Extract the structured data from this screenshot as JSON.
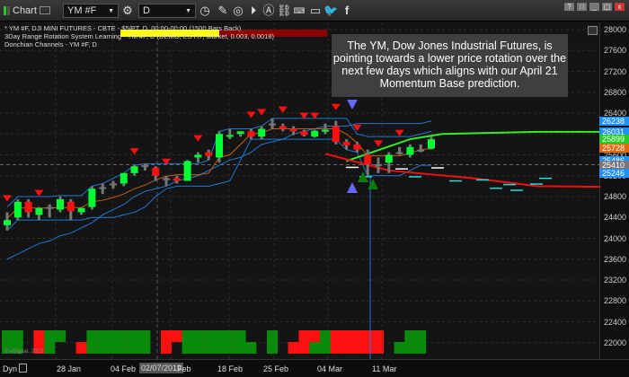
{
  "toolbar": {
    "app_label": "Chart",
    "symbol": "YM #F",
    "interval": "D",
    "icons": [
      "settings-icon",
      "clock-icon",
      "pencil-icon",
      "chart-link-icon",
      "play-icon",
      "alert-icon",
      "link-icon",
      "keyboard-icon",
      "chat-icon",
      "twitter-icon",
      "facebook-icon"
    ],
    "window_buttons": [
      "?",
      "□",
      "_",
      "▢",
      "x"
    ]
  },
  "legend": {
    "line1": "* YM #F, DJI MINI FUTURES - CBTE - $5/PT, D, 00:00-00:00 (1500 Bars Back)",
    "line2": "3Day Range Rotation System Learning - YM #F, D (DEMO, ES H7, Market, 0.003, 0.0018)",
    "line3": "Donchian Channels - YM #F, D"
  },
  "annotation": "The YM, Dow Jones Industrial Futures, is pointing towards a lower price rotation over the next few days which aligns with our April 21 Momentum Base prediction.",
  "copyright": "© eSignal, 2019",
  "time_axis": {
    "dyn": "Dyn",
    "labels": [
      "28 Jan",
      "04 Feb",
      "Feb",
      "18 Feb",
      "25 Feb",
      "04 Mar",
      "11 Mar"
    ],
    "cursor_date": "02/07/2019"
  },
  "price_badges": [
    {
      "value": "26238",
      "color": "#1e90ff"
    },
    {
      "value": "26031",
      "color": "#1e90ff"
    },
    {
      "value": "25899",
      "color": "#22cc22"
    },
    {
      "value": "25728",
      "color": "#e06a10"
    },
    {
      "value": "25486",
      "color": "#1e90ff"
    },
    {
      "value": "25410",
      "color": "#777777"
    },
    {
      "value": "25246",
      "color": "#1e90ff"
    }
  ],
  "chart_data": {
    "type": "candlestick",
    "ylim": [
      21600,
      28000
    ],
    "yticks": [
      28000,
      27600,
      27200,
      26800,
      26400,
      26000,
      25600,
      25200,
      24800,
      24400,
      24000,
      23600,
      23200,
      22800,
      22400,
      22000,
      21600
    ],
    "candles": [
      [
        24250,
        24500,
        24150,
        24350
      ],
      [
        24400,
        24750,
        24350,
        24700
      ],
      [
        24700,
        24750,
        24400,
        24500
      ],
      [
        24450,
        24600,
        24350,
        24580
      ],
      [
        24580,
        24650,
        24400,
        24600
      ],
      [
        24550,
        24800,
        24500,
        24750
      ],
      [
        24700,
        24750,
        24350,
        24520
      ],
      [
        24500,
        24600,
        24450,
        24580
      ],
      [
        24600,
        25000,
        24550,
        24950
      ],
      [
        24980,
        25050,
        24850,
        24980
      ],
      [
        25050,
        25100,
        24950,
        25050
      ],
      [
        25050,
        25250,
        25000,
        25250
      ],
      [
        25250,
        25400,
        25200,
        25380
      ],
      [
        25400,
        25430,
        25300,
        25400
      ],
      [
        25350,
        25380,
        25100,
        25200
      ],
      [
        25150,
        25200,
        25000,
        25150
      ],
      [
        25150,
        25200,
        25050,
        25100
      ],
      [
        25100,
        25500,
        25100,
        25480
      ],
      [
        25550,
        25650,
        25450,
        25600
      ],
      [
        25650,
        25700,
        25500,
        25580
      ],
      [
        25550,
        26050,
        25450,
        26000
      ],
      [
        25950,
        26100,
        25900,
        25980
      ],
      [
        26000,
        26050,
        25950,
        26050
      ],
      [
        26050,
        26100,
        25900,
        25950
      ],
      [
        25950,
        26150,
        25900,
        26100
      ],
      [
        26200,
        26300,
        26100,
        26200
      ],
      [
        26150,
        26200,
        26050,
        26100
      ],
      [
        26100,
        26150,
        25980,
        26050
      ],
      [
        26050,
        26080,
        25950,
        25980
      ],
      [
        25950,
        26080,
        25930,
        26060
      ],
      [
        26050,
        26200,
        26000,
        26080
      ],
      [
        26150,
        26250,
        25800,
        25850
      ],
      [
        25850,
        25900,
        25700,
        25780
      ],
      [
        25800,
        25850,
        25650,
        25700
      ],
      [
        25600,
        25700,
        25200,
        25420
      ],
      [
        25420,
        25550,
        25250,
        25400
      ],
      [
        25450,
        25650,
        25250,
        25600
      ],
      [
        25650,
        25750,
        25600,
        25630
      ],
      [
        25600,
        25800,
        25550,
        25750
      ],
      [
        25700,
        25800,
        25650,
        25700
      ],
      [
        25720,
        25950,
        25700,
        25900
      ]
    ],
    "donchian_upper": [
      24600,
      24800,
      24800,
      24800,
      24800,
      24820,
      24820,
      24820,
      25000,
      25050,
      25150,
      25250,
      25400,
      25430,
      25430,
      25430,
      25430,
      25430,
      25430,
      25500,
      26050,
      26100,
      26100,
      26100,
      26150,
      26300,
      26300,
      26300,
      26300,
      26300,
      26300,
      26300,
      26300,
      26000,
      25950,
      25950,
      25950,
      25950,
      25950,
      26000,
      26050
    ],
    "donchian_lower": [
      24150,
      24350,
      24350,
      24350,
      24350,
      24350,
      24350,
      24350,
      24400,
      24400,
      24400,
      24450,
      24500,
      24600,
      24800,
      24950,
      25000,
      25000,
      25000,
      25000,
      25050,
      25100,
      25500,
      25900,
      25900,
      25900,
      25900,
      25900,
      25900,
      25900,
      25900,
      25900,
      25700,
      25650,
      25200,
      25200,
      25200,
      25200,
      25300,
      25400,
      25400
    ],
    "donchian_mid": [
      24380,
      24580,
      24580,
      24580,
      24580,
      24590,
      24590,
      24590,
      24700,
      24730,
      24780,
      24850,
      24950,
      25020,
      25120,
      25190,
      25220,
      25220,
      25220,
      25250,
      25550,
      25600,
      25800,
      26000,
      26020,
      26100,
      26100,
      26100,
      26100,
      26100,
      26100,
      26100,
      26000,
      25830,
      25580,
      25580,
      25580,
      25580,
      25630,
      25700,
      25720
    ],
    "outer_band": [
      23600,
      23700,
      23800,
      23900,
      23950,
      24050,
      24100,
      24200,
      24300,
      24450,
      24550,
      24650,
      24800,
      24900,
      24950,
      25000,
      25100,
      25150,
      25200,
      25300,
      25400,
      25500,
      25550,
      25650,
      25800,
      25850,
      25900,
      26000,
      26050,
      26100,
      26150,
      26150,
      26150,
      26200,
      26200,
      26200,
      26200,
      26200,
      26200,
      26200,
      26250
    ],
    "sell_signals": [
      0,
      3,
      12,
      15,
      18,
      23,
      24,
      26,
      28,
      29,
      31,
      33,
      35,
      37
    ],
    "projection_up": [
      [
        32,
        25480
      ],
      [
        38,
        25900
      ],
      [
        41,
        26000
      ],
      [
        50,
        26040
      ],
      [
        60,
        26040
      ]
    ],
    "projection_down": [
      [
        30,
        25620
      ],
      [
        36,
        25300
      ],
      [
        44,
        25150
      ],
      [
        50,
        25000
      ],
      [
        60,
        24980
      ]
    ]
  },
  "histogram": [
    [
      "g",
      "g"
    ],
    [
      "g",
      "g"
    ],
    [
      null,
      null
    ],
    [
      "r",
      "r"
    ],
    [
      "g",
      "g"
    ],
    [
      "g",
      null
    ],
    [
      null,
      null
    ],
    [
      null,
      "r"
    ],
    [
      "g",
      "g"
    ],
    [
      "g",
      "g"
    ],
    [
      "g",
      "g"
    ],
    [
      "g",
      "g"
    ],
    [
      "g",
      "g"
    ],
    [
      "g",
      "g"
    ],
    [
      null,
      null
    ],
    [
      "r",
      "r"
    ],
    [
      "r",
      null
    ],
    [
      "g",
      "g"
    ],
    [
      "g",
      "g"
    ],
    [
      "g",
      "g"
    ],
    [
      "g",
      "g"
    ],
    [
      "g",
      "g"
    ],
    [
      "g",
      "g"
    ],
    [
      null,
      "g"
    ],
    [
      null,
      null
    ],
    [
      "g",
      "g"
    ],
    [
      null,
      null
    ],
    [
      null,
      "r"
    ],
    [
      "r",
      "r"
    ],
    [
      "r",
      "g"
    ],
    [
      "g",
      "g"
    ],
    [
      "r",
      "r"
    ],
    [
      "r",
      "r"
    ],
    [
      "r",
      "r"
    ],
    [
      "r",
      "r"
    ],
    [
      "r",
      "r"
    ],
    [
      null,
      null
    ],
    [
      null,
      "g"
    ],
    [
      "g",
      "g"
    ],
    [
      "g",
      "g"
    ],
    [
      null,
      null
    ]
  ],
  "colors": {
    "up": "#00ff33",
    "down": "#ff1010",
    "neutral": "#777777",
    "band": "#1e78d0",
    "mid": "#c06010"
  }
}
